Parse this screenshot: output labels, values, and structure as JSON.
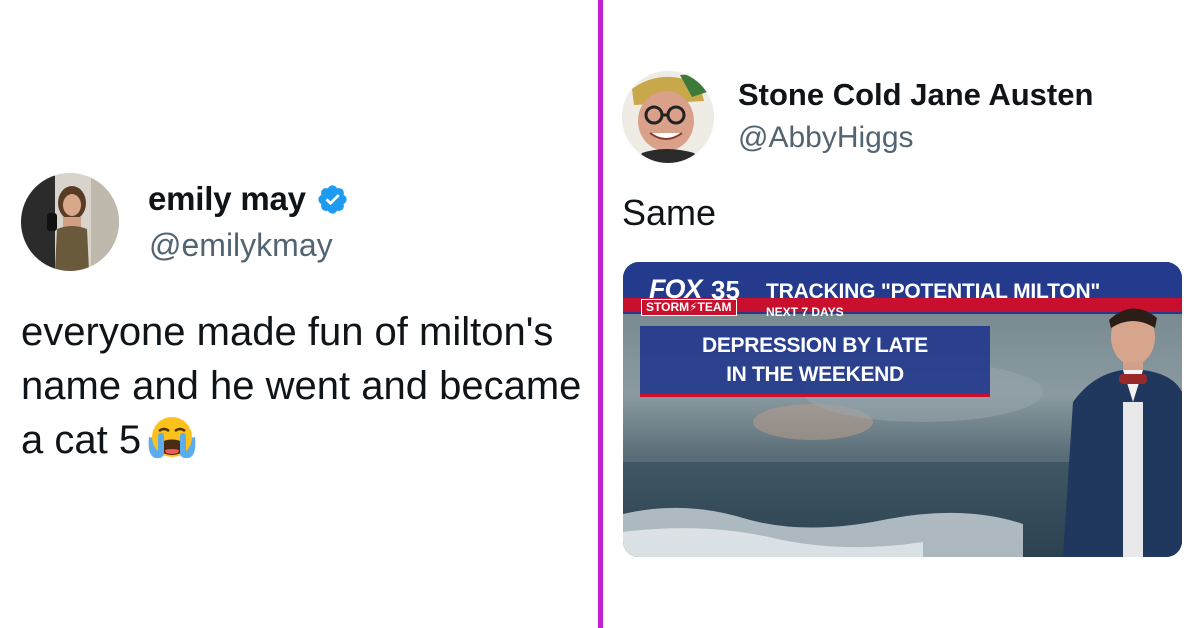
{
  "left_tweet": {
    "display_name": "emily may",
    "handle": "@emilykmay",
    "text": "everyone made fun of milton's name and he went and became a cat 5",
    "emoji_icon": "loudly-crying-face-icon",
    "verified_icon": "verified-badge-icon"
  },
  "right_tweet": {
    "display_name": "Stone Cold Jane Austen",
    "handle": "@AbbyHiggs",
    "text": "Same",
    "media": {
      "logo": "FOX",
      "channel": "35",
      "team": "STORM⚡TEAM",
      "headline": "TRACKING \"POTENTIAL MILTON\"",
      "subline": "NEXT 7 DAYS",
      "graphic_line1": "DEPRESSION BY LATE",
      "graphic_line2": "IN THE WEEKEND"
    }
  },
  "colors": {
    "divider": "#c21fd6",
    "handle": "#536471",
    "verified": "#1d9bf0",
    "news_red": "#c8102e",
    "news_blue": "#243a8c"
  }
}
